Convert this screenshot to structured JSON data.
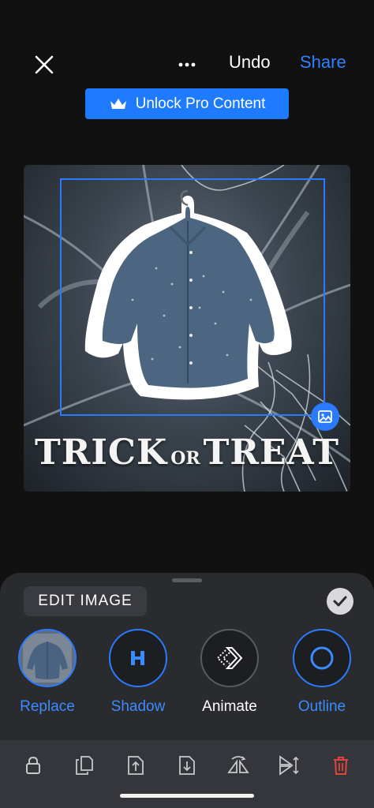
{
  "topbar": {
    "close_icon": "close-icon",
    "more_icon": "more-horizontal-icon",
    "undo_label": "Undo",
    "share_label": "Share"
  },
  "pro_button": {
    "icon": "crown-icon",
    "label": "Unlock Pro Content"
  },
  "canvas": {
    "text_main_left": "TRICK",
    "text_small": "OR",
    "text_main_right": "TREAT",
    "badge_icon": "image-icon"
  },
  "sheet": {
    "title": "EDIT IMAGE",
    "confirm_icon": "checkmark-icon",
    "tools": [
      {
        "label": "Replace",
        "icon": "shirt-thumbnail"
      },
      {
        "label": "Shadow",
        "icon": "shadow-icon"
      },
      {
        "label": "Animate",
        "icon": "animate-icon"
      },
      {
        "label": "Outline",
        "icon": "outline-icon"
      }
    ]
  },
  "toolbar": {
    "icons": [
      "lock-icon",
      "duplicate-icon",
      "bring-forward-icon",
      "send-backward-icon",
      "flip-horizontal-icon",
      "flip-vertical-icon",
      "trash-icon"
    ]
  },
  "colors": {
    "accent": "#2a7bff",
    "background": "#111112",
    "sheet": "#2a2b2f",
    "toolbar": "#35363b",
    "danger": "#e0443a"
  }
}
